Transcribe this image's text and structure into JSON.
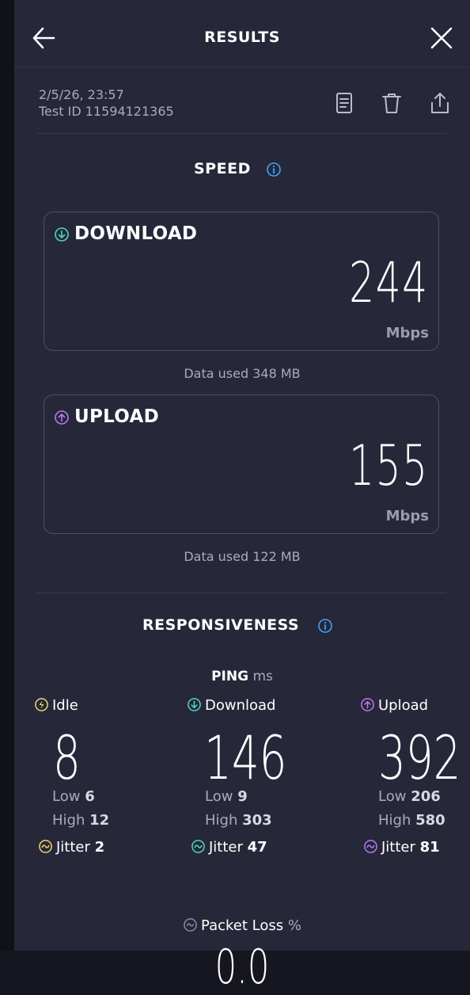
{
  "header": {
    "title": "RESULTS",
    "back_icon": "arrow-left-icon",
    "close_icon": "close-icon"
  },
  "meta": {
    "date": "2/5/26, 23:57",
    "test_id": "Test ID 11594121365"
  },
  "actions": {
    "report_icon": "document-icon",
    "delete_icon": "trash-icon",
    "share_icon": "share-icon"
  },
  "speed": {
    "title": "SPEED",
    "download": {
      "label": "DOWNLOAD",
      "value": "244",
      "unit": "Mbps",
      "data_used": "Data used 348 MB",
      "color": "#4ed5c9"
    },
    "upload": {
      "label": "UPLOAD",
      "value": "155",
      "unit": "Mbps",
      "data_used": "Data used 122 MB",
      "color": "#b57bf0"
    }
  },
  "responsiveness": {
    "title": "RESPONSIVENESS",
    "ping_label": "PING",
    "ping_unit": "ms",
    "idle": {
      "label": "Idle",
      "value": "8",
      "low_label": "Low",
      "low": "6",
      "high_label": "High",
      "high": "12",
      "jitter_label": "Jitter",
      "jitter": "2",
      "color": "#f1d36b"
    },
    "download": {
      "label": "Download",
      "value": "146",
      "low_label": "Low",
      "low": "9",
      "high_label": "High",
      "high": "303",
      "jitter_label": "Jitter",
      "jitter": "47",
      "color": "#4ed5c9"
    },
    "upload": {
      "label": "Upload",
      "value": "392",
      "low_label": "Low",
      "low": "206",
      "high_label": "High",
      "high": "580",
      "jitter_label": "Jitter",
      "jitter": "81",
      "color": "#b57bf0"
    },
    "packet_loss": {
      "label": "Packet Loss",
      "unit": "%",
      "value": "0.0"
    }
  },
  "colors": {
    "background": "#262839",
    "info": "#3ea5f5"
  }
}
